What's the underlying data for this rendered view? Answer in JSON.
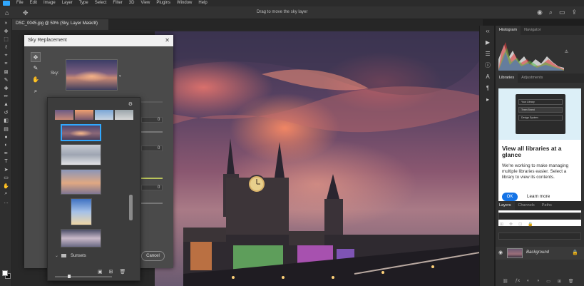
{
  "menubar": {
    "items": [
      "File",
      "Edit",
      "Image",
      "Layer",
      "Type",
      "Select",
      "Filter",
      "3D",
      "View",
      "Plugins",
      "Window",
      "Help"
    ]
  },
  "optionsbar": {
    "hint": "Drag to move the sky layer"
  },
  "document": {
    "tab_title": "DSC_0045.jpg @ 50% (Sky, Layer Mask/8)"
  },
  "dialog": {
    "title": "Sky Replacement",
    "sky_label": "Sky:",
    "field_values": [
      "0",
      "0",
      "0"
    ],
    "cancel_label": "Cancel",
    "folder_name": "Sunsets"
  },
  "panels": {
    "top_tabs": [
      "Histogram",
      "Navigator"
    ],
    "library_tabs": [
      "Libraries",
      "Adjustments"
    ],
    "library_card": {
      "mini_items": [
        "Your Library",
        "Team Brand",
        "Design System"
      ],
      "heading": "View all libraries at a glance",
      "body": "We're working to make managing multiple libraries easier. Select a library to view its contents.",
      "ok_label": "OK",
      "learn_label": "Learn more"
    },
    "layer_tabs": [
      "Layers",
      "Channels",
      "Paths"
    ],
    "layer_name": "Background"
  },
  "colors": {
    "accent": "#31a8ff",
    "ok_button": "#1473e6"
  }
}
